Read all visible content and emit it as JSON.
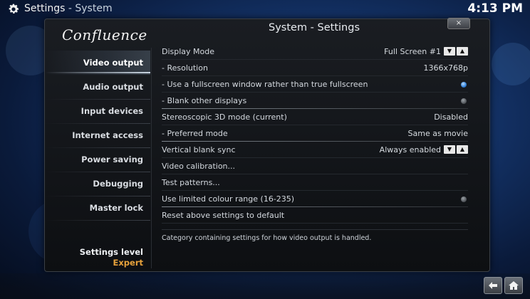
{
  "topbar": {
    "app": "Settings",
    "separator": " - ",
    "section": "System",
    "clock": "4:13 PM"
  },
  "window": {
    "header_title": "System - Settings",
    "logo_text": "Confluence",
    "close_glyph": "×"
  },
  "sidebar": {
    "items": [
      {
        "label": "Video output",
        "active": true
      },
      {
        "label": "Audio output"
      },
      {
        "label": "Input devices"
      },
      {
        "label": "Internet access"
      },
      {
        "label": "Power saving"
      },
      {
        "label": "Debugging"
      },
      {
        "label": "Master lock"
      }
    ],
    "level_label": "Settings level",
    "level_value": "Expert"
  },
  "settings": {
    "rows": [
      {
        "label": "Display Mode",
        "value": "Full Screen #1",
        "control": "spinner"
      },
      {
        "label": "- Resolution",
        "value": "1366x768p"
      },
      {
        "label": "- Use a fullscreen window rather than true fullscreen",
        "control": "radio",
        "checked": true
      },
      {
        "label": "- Blank other displays",
        "control": "radio",
        "checked": false
      },
      {
        "label": "Stereoscopic 3D mode (current)",
        "value": "Disabled"
      },
      {
        "label": "- Preferred mode",
        "value": "Same as movie"
      },
      {
        "label": "Vertical blank sync",
        "value": "Always enabled",
        "control": "spinner"
      },
      {
        "label": "Video calibration..."
      },
      {
        "label": "Test patterns..."
      },
      {
        "label": "Use limited colour range (16-235)",
        "control": "radio",
        "checked": false
      },
      {
        "label": "Reset above settings to default"
      }
    ],
    "spinner": {
      "down": "▼",
      "up": "▲"
    }
  },
  "description": "Category containing settings for how video output is handled.",
  "icons": {
    "gear": "gear-icon",
    "back": "back-arrow-icon",
    "home": "home-icon"
  },
  "colors": {
    "accent_orange": "#e6a13b",
    "radio_on": "#2f7fd8"
  }
}
